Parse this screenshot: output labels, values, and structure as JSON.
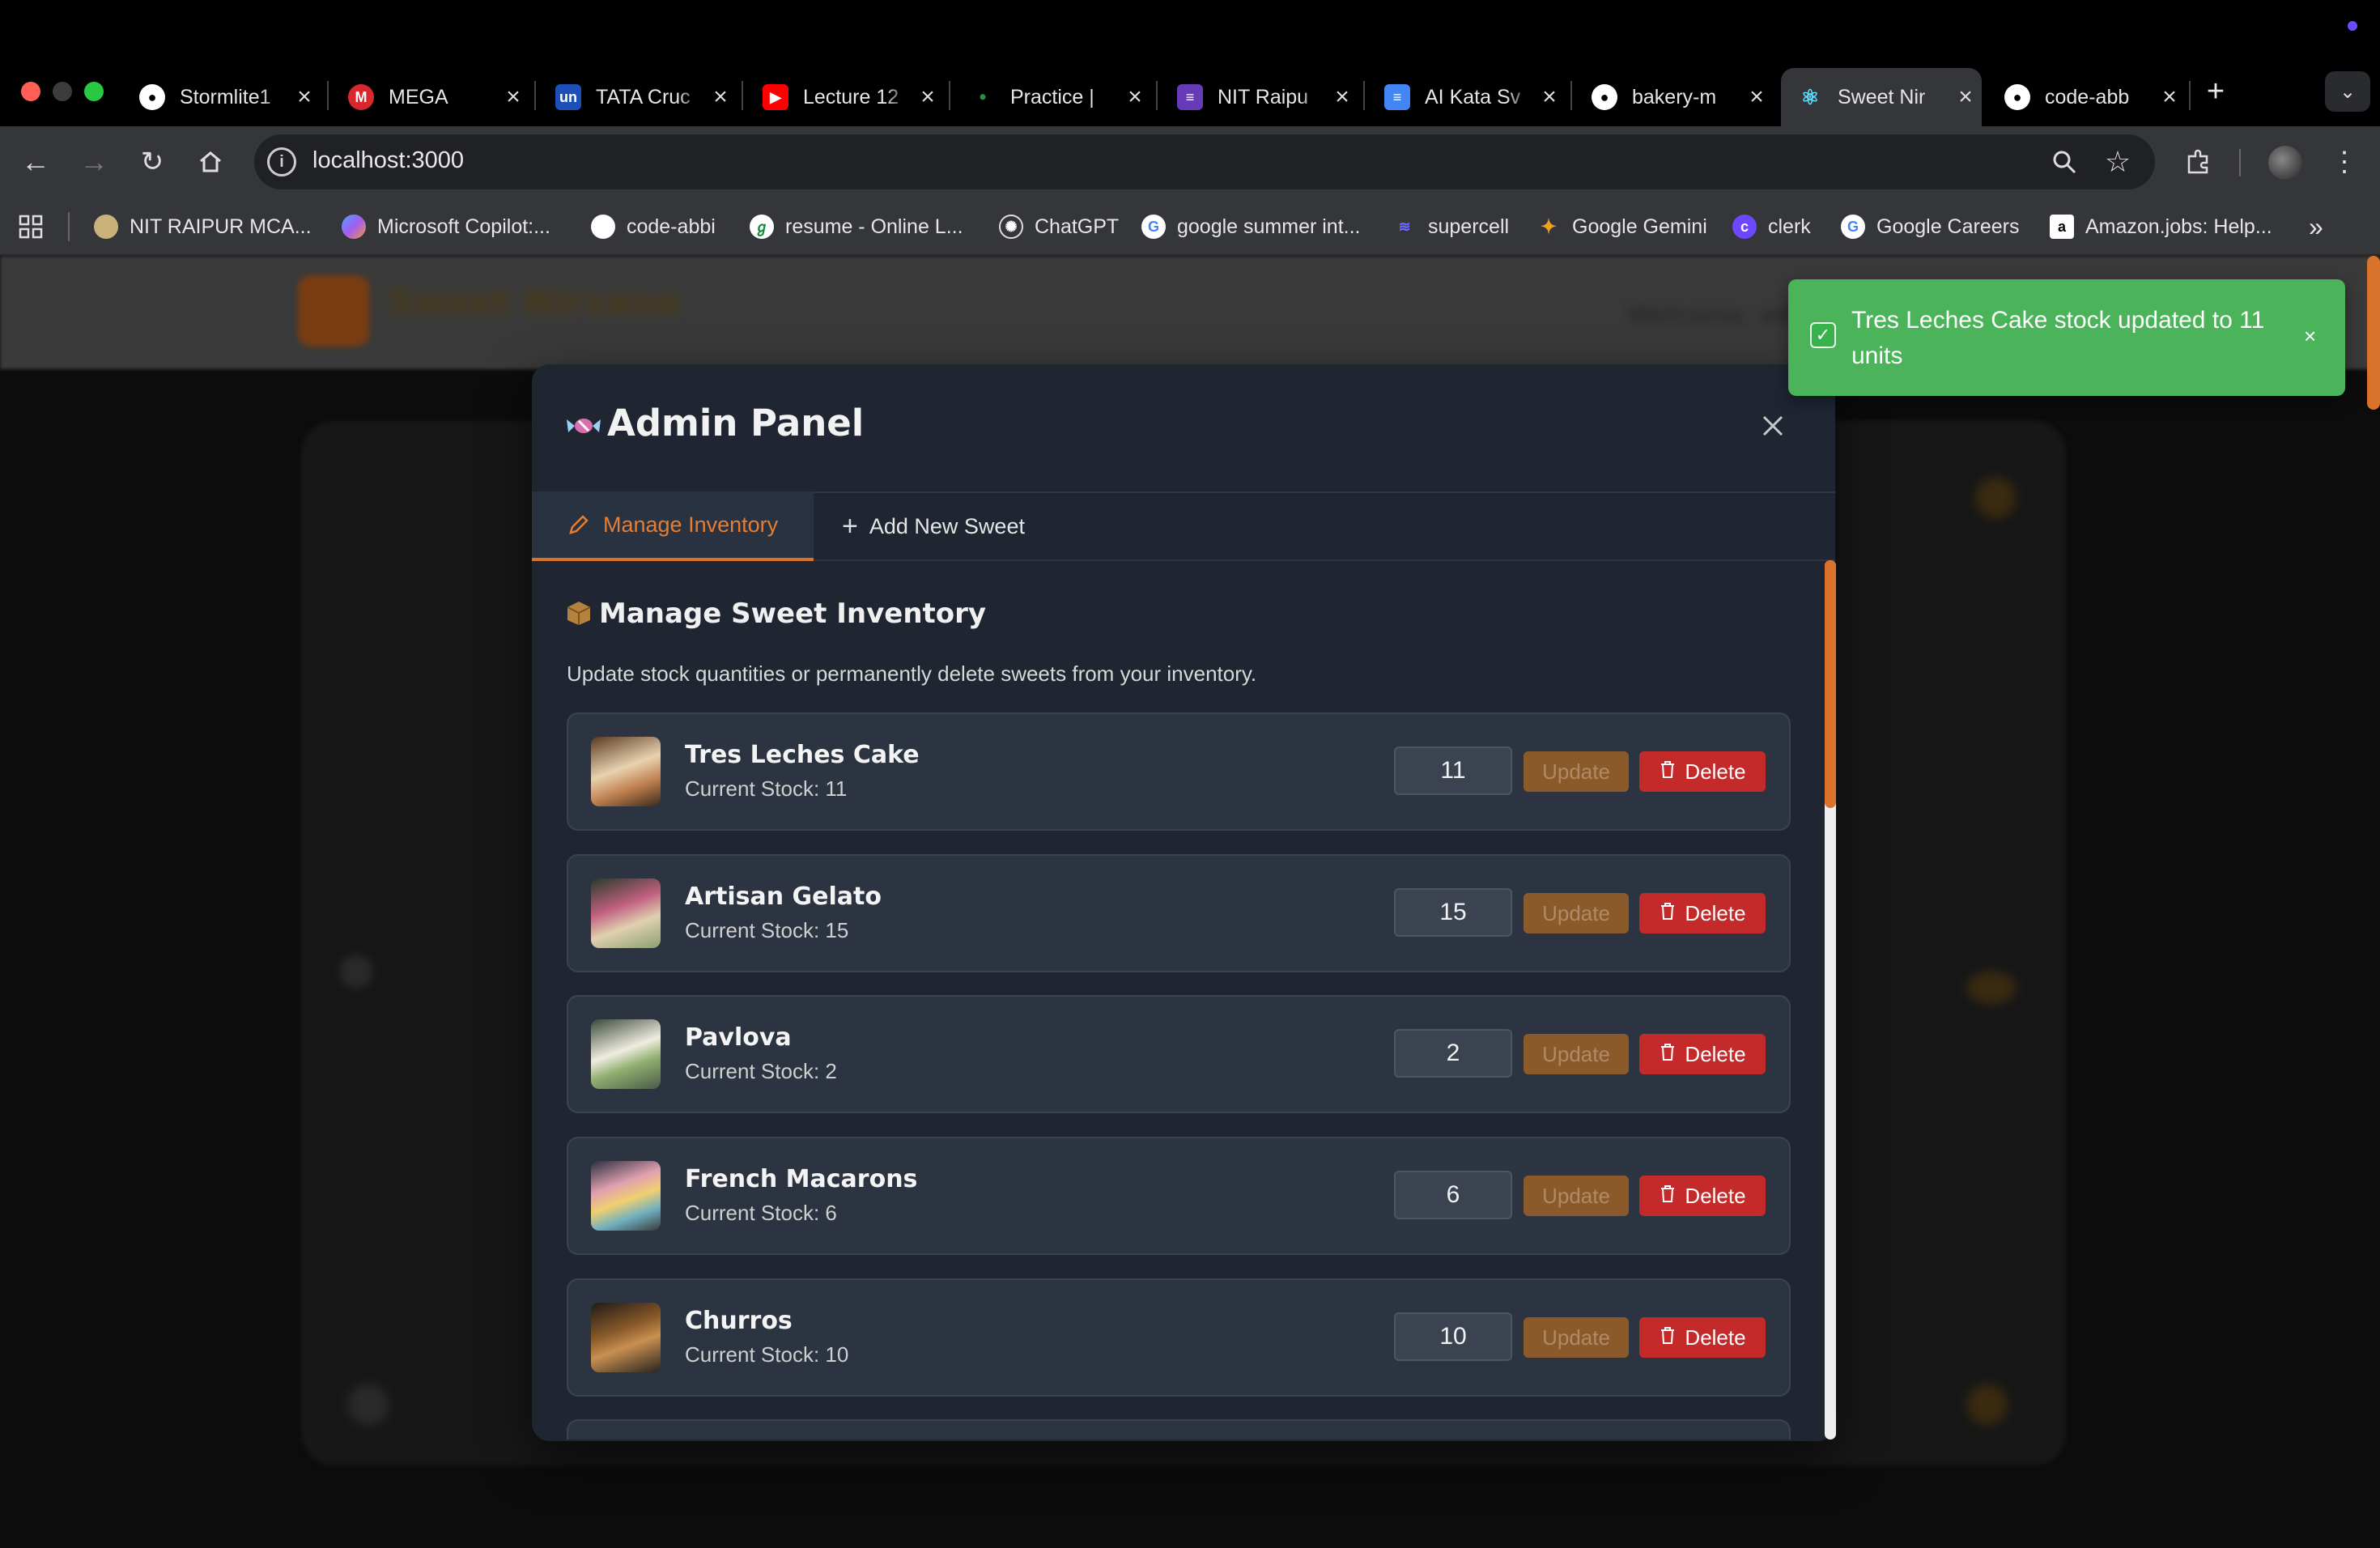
{
  "browser": {
    "tabs": [
      {
        "label": "Stormlite1",
        "icon": "github-icon",
        "active": false
      },
      {
        "label": "MEGA",
        "icon": "mega-icon",
        "active": false
      },
      {
        "label": "TATA Cruc",
        "icon": "unstop-icon",
        "active": false
      },
      {
        "label": "Lecture 12",
        "icon": "youtube-icon",
        "active": false
      },
      {
        "label": "Practice |",
        "icon": "gfg-icon",
        "active": false
      },
      {
        "label": "NIT Raipu",
        "icon": "forms-icon",
        "active": false
      },
      {
        "label": "AI Kata Sv",
        "icon": "docs-icon",
        "active": false
      },
      {
        "label": "bakery-m",
        "icon": "github-icon",
        "active": false
      },
      {
        "label": "Sweet Nir",
        "icon": "react-icon",
        "active": true
      },
      {
        "label": "code-abb",
        "icon": "github-icon",
        "active": false
      }
    ],
    "new_tab": "+",
    "url": "localhost:3000",
    "bookmarks": [
      {
        "label": "NIT RAIPUR MCA...",
        "icon": "nit-icon",
        "color": "#c9b27a"
      },
      {
        "label": "Microsoft Copilot:...",
        "icon": "copilot-icon",
        "color": "#7c6cf0"
      },
      {
        "label": "code-abbi",
        "icon": "github-icon",
        "color": "#ffffff"
      },
      {
        "label": "resume - Online L...",
        "icon": "overleaf-icon",
        "color": "#ffffff"
      },
      {
        "label": "ChatGPT",
        "icon": "chatgpt-icon",
        "color": "#ffffff"
      },
      {
        "label": "google summer int...",
        "icon": "google-icon",
        "color": "#ffffff"
      },
      {
        "label": "supercell",
        "icon": "supercell-icon",
        "color": "#6b6bff"
      },
      {
        "label": "Google Gemini",
        "icon": "gemini-icon",
        "color": "#f0a020"
      },
      {
        "label": "clerk",
        "icon": "clerk-icon",
        "color": "#6c47ff"
      },
      {
        "label": "Google Careers",
        "icon": "google-icon",
        "color": "#ffffff"
      },
      {
        "label": "Amazon.jobs: Help...",
        "icon": "amazon-icon",
        "color": "#ffffff"
      }
    ]
  },
  "modal": {
    "title": "Admin Panel",
    "tabs": {
      "manage": "Manage Inventory",
      "add": "Add New Sweet"
    },
    "section_title": "Manage Sweet Inventory",
    "section_desc": "Update stock quantities or permanently delete sweets from your inventory.",
    "update_label": "Update",
    "delete_label": "Delete",
    "items": [
      {
        "name": "Tres Leches Cake",
        "stock": "Current Stock: 11",
        "qty": "11"
      },
      {
        "name": "Artisan Gelato",
        "stock": "Current Stock: 15",
        "qty": "15"
      },
      {
        "name": "Pavlova",
        "stock": "Current Stock: 2",
        "qty": "2"
      },
      {
        "name": "French Macarons",
        "stock": "Current Stock: 6",
        "qty": "6"
      },
      {
        "name": "Churros",
        "stock": "Current Stock: 10",
        "qty": "10"
      }
    ]
  },
  "toast": {
    "message": "Tres Leches Cake stock updated to 11 units",
    "close": "×"
  },
  "background": {
    "brand": "Sweet Nirvana",
    "welcome": "Welcome, adm"
  },
  "colors": {
    "accent": "#d9732b",
    "danger": "#c42a2a",
    "success": "#4bb35a",
    "modal_bg": "#1f2632"
  }
}
